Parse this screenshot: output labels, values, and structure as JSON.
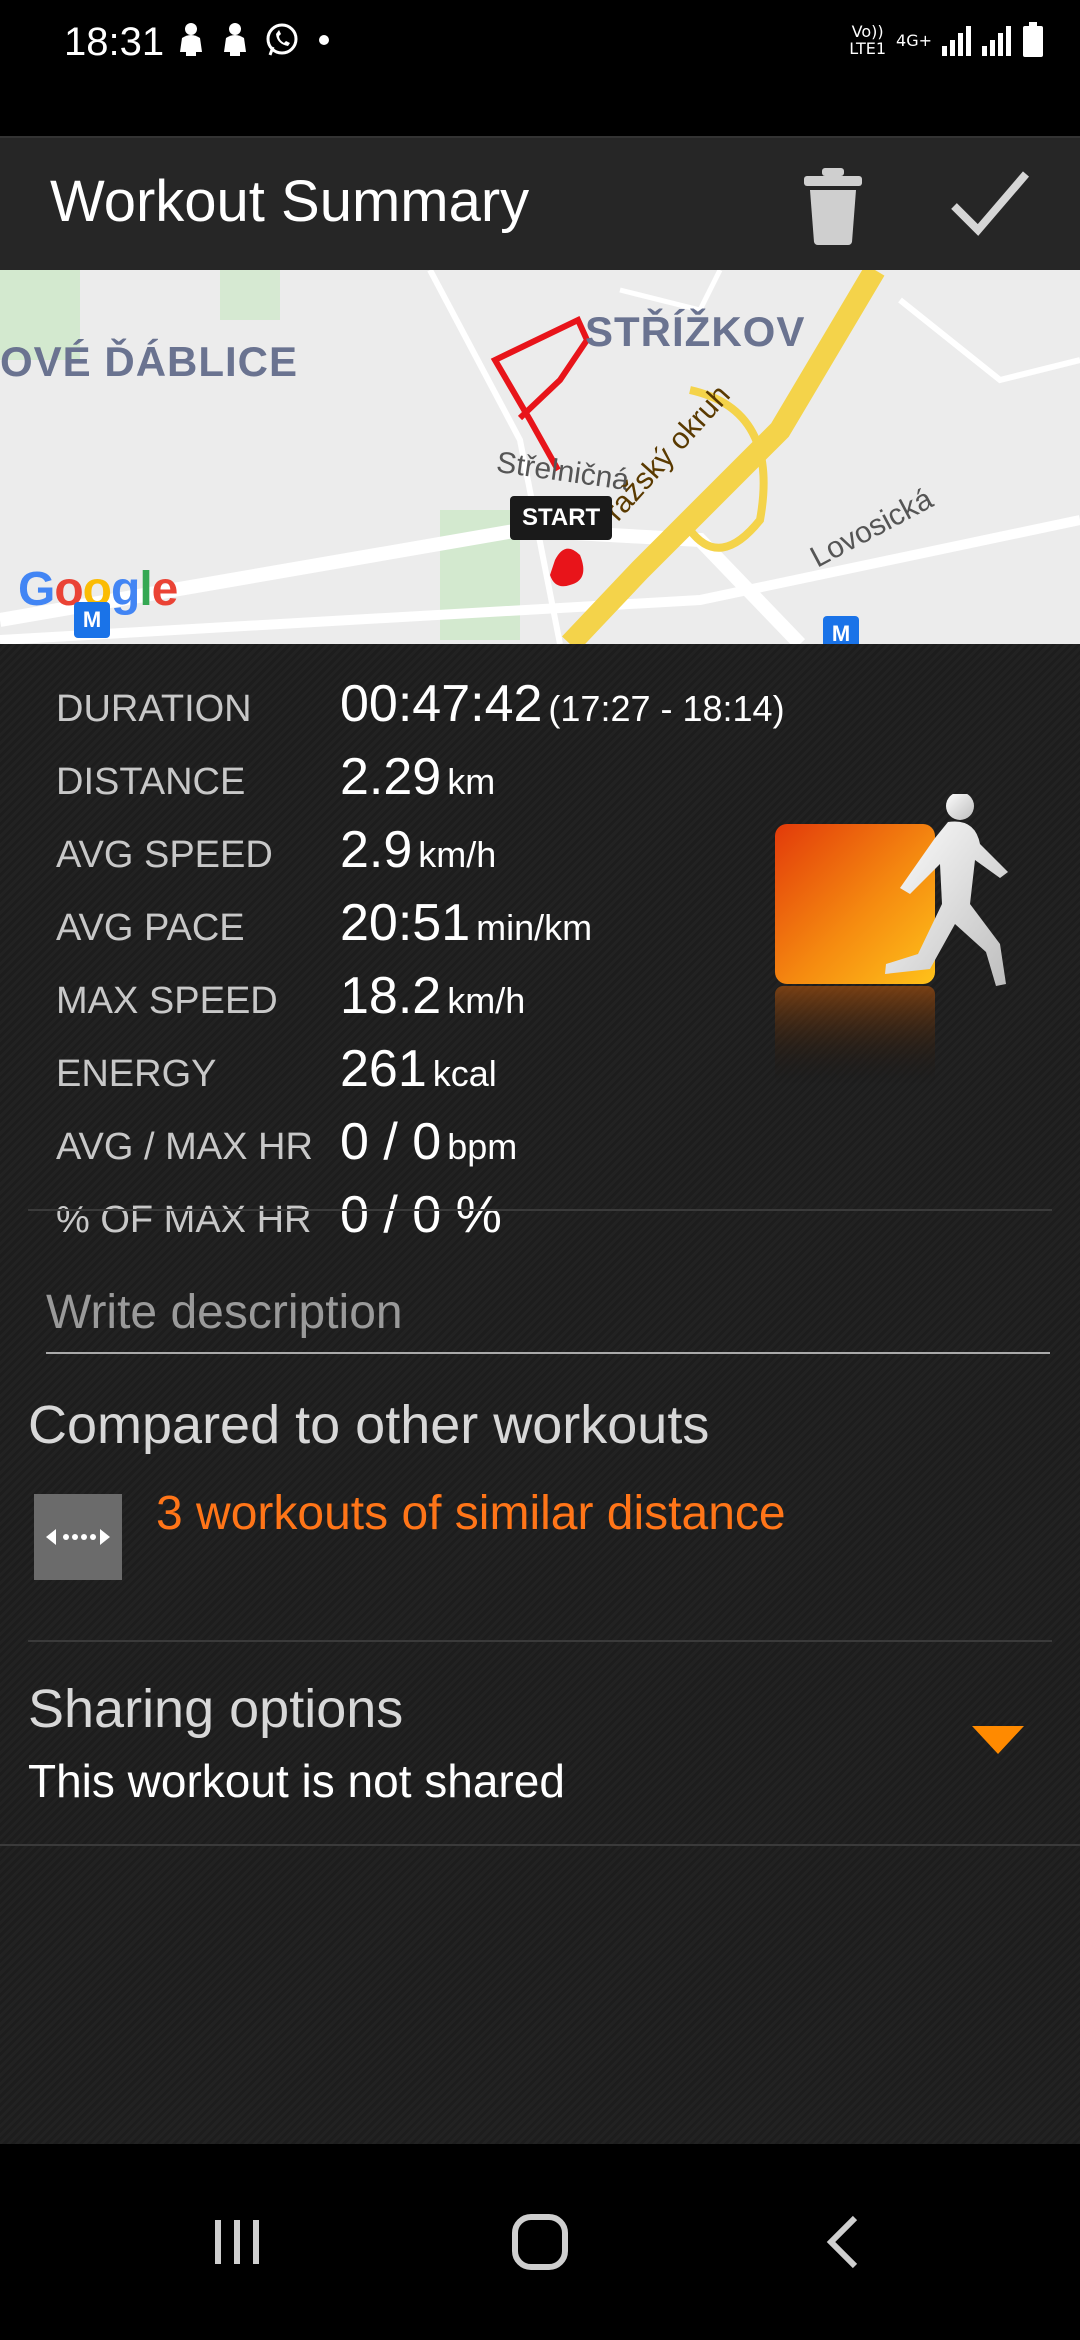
{
  "status_bar": {
    "time": "18:31",
    "notification_icons": [
      "notification-icon",
      "notification-icon",
      "whatsapp-icon",
      "dot-icon"
    ],
    "network_line1": "Vo))",
    "network_line2": "LTE1",
    "network_gen": "4G+"
  },
  "app_bar": {
    "title": "Workout Summary",
    "delete_icon": "trash-icon",
    "confirm_icon": "check-icon"
  },
  "map": {
    "area_label_left": "OVÉ ĎÁBLICE",
    "area_label_right": "STŘÍŽKOV",
    "street_1": "Střelničná",
    "street_2": "Pražský okruh",
    "street_3": "Lovosická",
    "start_label": "START",
    "google": "Google",
    "metro_label": "M",
    "route_color": "#e8141a"
  },
  "stats": [
    {
      "label": "DURATION",
      "value": "00:47:42",
      "unit": "(17:27 - 18:14)"
    },
    {
      "label": "DISTANCE",
      "value": "2.29",
      "unit": "km"
    },
    {
      "label": "AVG SPEED",
      "value": "2.9",
      "unit": "km/h"
    },
    {
      "label": "AVG PACE",
      "value": "20:51",
      "unit": "min/km"
    },
    {
      "label": "MAX SPEED",
      "value": "18.2",
      "unit": "km/h"
    },
    {
      "label": "ENERGY",
      "value": "261",
      "unit": "kcal"
    },
    {
      "label": "AVG / MAX HR",
      "value": "0 / 0",
      "unit": "bpm"
    },
    {
      "label": "% OF MAX HR",
      "value": "0 / 0 %",
      "unit": ""
    }
  ],
  "description": {
    "placeholder": "Write description",
    "value": ""
  },
  "compare": {
    "title": "Compared to other workouts",
    "link_text": "3 workouts of similar distance",
    "icon": "distance-arrows-icon",
    "link_color": "#ff7518"
  },
  "sharing": {
    "title": "Sharing options",
    "status": "This workout is not shared",
    "arrow_icon": "dropdown-triangle-icon",
    "arrow_color": "#ff8a00"
  },
  "nav_bar": {
    "recents_icon": "recents-icon",
    "home_icon": "home-icon",
    "back_icon": "back-icon"
  },
  "colors": {
    "accent": "#ff7518",
    "app_bar": "#262626",
    "background": "#1d1d1d"
  }
}
